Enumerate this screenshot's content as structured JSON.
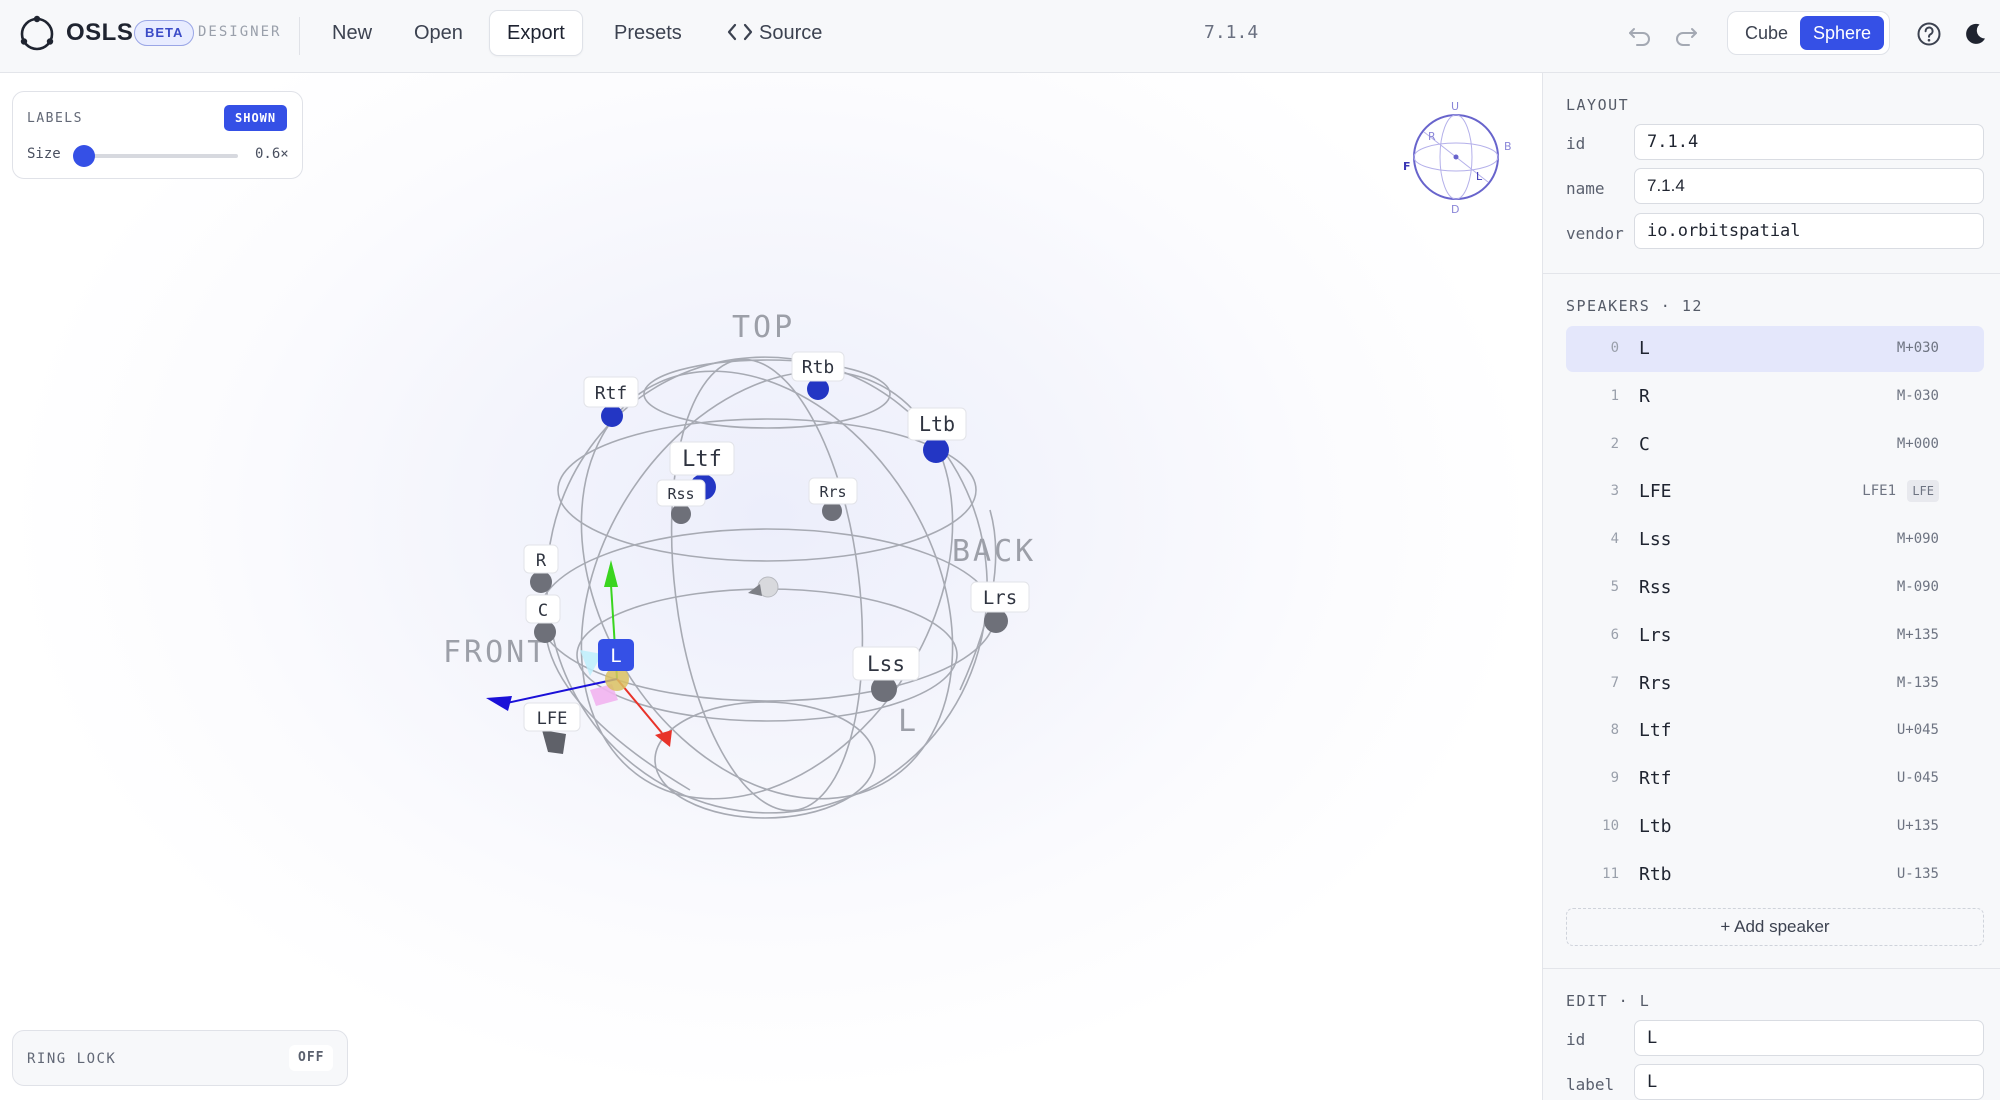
{
  "app": {
    "name": "OSLS",
    "badge": "BETA",
    "mode": "DESIGNER",
    "version": "7.1.4"
  },
  "menu": {
    "new_label": "New",
    "open_label": "Open",
    "export_label": "Export",
    "presets_label": "Presets",
    "source_label": "Source",
    "active": "Export"
  },
  "view_toggle": {
    "cube_label": "Cube",
    "sphere_label": "Sphere",
    "selected": "Sphere"
  },
  "labels_panel": {
    "title": "LABELS",
    "toggle_label": "SHOWN",
    "size_label": "Size",
    "size_value": "0.6×",
    "size_level": 0.0
  },
  "ring_lock": {
    "title": "RING LOCK",
    "state": "OFF"
  },
  "scene": {
    "face_labels": {
      "top": "TOP",
      "front": "FRONT",
      "back": "BACK",
      "left": "L"
    },
    "speaker_labels": {
      "rtb": "Rtb",
      "rtf": "Rtf",
      "ltb": "Ltb",
      "ltf": "Ltf",
      "rss": "Rss",
      "rrs": "Rrs",
      "r": "R",
      "c": "C",
      "l": "L",
      "lrs": "Lrs",
      "lss": "Lss",
      "lfe": "LFE"
    },
    "orientation_gizmo": {
      "up": "U",
      "down": "D",
      "front": "F",
      "back": "B",
      "right": "R",
      "left": "L"
    }
  },
  "layout_section": {
    "title": "LAYOUT",
    "id_label": "id",
    "id_value": "7.1.4",
    "name_label": "name",
    "name_value": "7.1.4",
    "vendor_label": "vendor",
    "vendor_value": "io.orbitspatial"
  },
  "speakers_section": {
    "title": "SPEAKERS · 12",
    "add_label": "+ Add speaker",
    "selected_index": 0,
    "items": [
      {
        "index": "0",
        "name": "L",
        "code": "M+030",
        "tag": ""
      },
      {
        "index": "1",
        "name": "R",
        "code": "M-030",
        "tag": ""
      },
      {
        "index": "2",
        "name": "C",
        "code": "M+000",
        "tag": ""
      },
      {
        "index": "3",
        "name": "LFE",
        "code": "LFE1",
        "tag": "LFE"
      },
      {
        "index": "4",
        "name": "Lss",
        "code": "M+090",
        "tag": ""
      },
      {
        "index": "5",
        "name": "Rss",
        "code": "M-090",
        "tag": ""
      },
      {
        "index": "6",
        "name": "Lrs",
        "code": "M+135",
        "tag": ""
      },
      {
        "index": "7",
        "name": "Rrs",
        "code": "M-135",
        "tag": ""
      },
      {
        "index": "8",
        "name": "Ltf",
        "code": "U+045",
        "tag": ""
      },
      {
        "index": "9",
        "name": "Rtf",
        "code": "U-045",
        "tag": ""
      },
      {
        "index": "10",
        "name": "Ltb",
        "code": "U+135",
        "tag": ""
      },
      {
        "index": "11",
        "name": "Rtb",
        "code": "U-135",
        "tag": ""
      }
    ]
  },
  "edit_section": {
    "title": "EDIT · L",
    "id_label": "id",
    "id_value": "L",
    "label_label": "label",
    "label_value": "L"
  },
  "colors": {
    "accent": "#3550e6",
    "upper_speaker": "#2336c4",
    "mid_speaker": "#6e7079",
    "x_axis": "#e8332a",
    "y_axis": "#3ad51f",
    "z_axis": "#1a10d8"
  }
}
